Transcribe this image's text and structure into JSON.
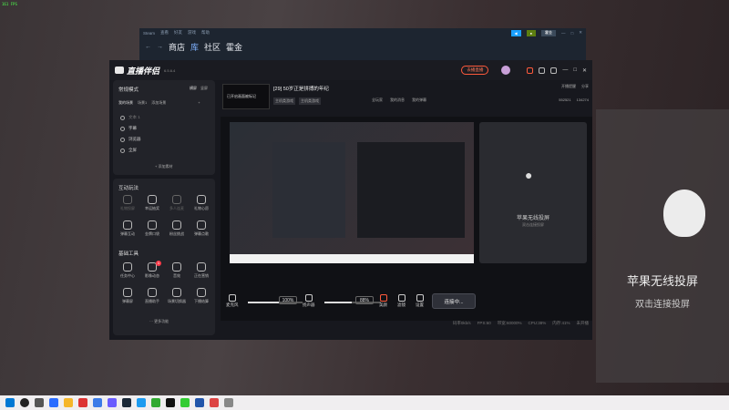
{
  "overlay": {
    "fps": "161 FPS"
  },
  "steam": {
    "menu": [
      "Steam",
      "查看",
      "好友",
      "游戏",
      "帮助"
    ],
    "nav": [
      "商店",
      "库",
      "社区",
      "霍金"
    ],
    "user": "霍金",
    "colors": {
      "accent": "#1a9fff",
      "green": "#5c7e10"
    }
  },
  "app": {
    "name": "直播伴侣",
    "version": "6.5.6.4",
    "header_button": "去播直播",
    "window_controls": [
      "—",
      "□",
      "✕"
    ]
  },
  "scene": {
    "mode_label": "常规模式",
    "mode_actions": [
      "横屏",
      "竖屏"
    ],
    "tabs": [
      "我的场景",
      "场景1",
      "添加场景"
    ],
    "sources": [
      "文本 1",
      "字幕",
      "浏览器",
      "全屏"
    ],
    "add_source": "添加素材"
  },
  "interactive": {
    "title": "互动玩法",
    "tools": [
      "礼物投屏",
      "幸运抽奖",
      "多人连麦",
      "礼物心愿",
      "弹幕互动",
      "金牌口袋",
      "粉丝挑战",
      "弹幕点歌"
    ]
  },
  "basic": {
    "title": "基础工具",
    "tools": [
      "任务中心",
      "影像动态",
      "音效",
      "正在营销",
      "弹幕屏",
      "直播助手",
      "场景切换器",
      "下播结算"
    ],
    "badge": "1",
    "more": "更多功能"
  },
  "stream": {
    "title": "[29] 50岁正是拼搏的年纪",
    "thumb_text": "已开启画面被标记",
    "tags": [
      "主机类游戏",
      "主机类游戏"
    ],
    "links": [
      "全玩家",
      "我的消息",
      "我的弹幕"
    ],
    "share": "分享",
    "danmaku": "开播提醒",
    "stats": {
      "likes": "552521",
      "followers": "134274"
    }
  },
  "airplay": {
    "title": "苹果无线投屏",
    "subtitle": "双击连接投屏",
    "sub_small": "双击连接投屏"
  },
  "controls": {
    "mic_label": "麦克风",
    "mic_value": "100%",
    "mic_level": 1.0,
    "speaker_label": "扬声器",
    "speaker_value": "88%",
    "speaker_level": 0.88,
    "icons": [
      "美颜",
      "滤镜",
      "设置"
    ],
    "connect": "连接中..."
  },
  "status": [
    "码率0kb/s",
    "FPS:60",
    "带宽:60000%",
    "CPU:38%",
    "内存:41%",
    "未开播"
  ],
  "right": {
    "tabs": [
      "贡献榜",
      "1/2万",
      "开播天数",
      "详情"
    ],
    "text1": "弹幕区域",
    "text2": "暂无弹幕内容",
    "button": "暂无信息"
  }
}
